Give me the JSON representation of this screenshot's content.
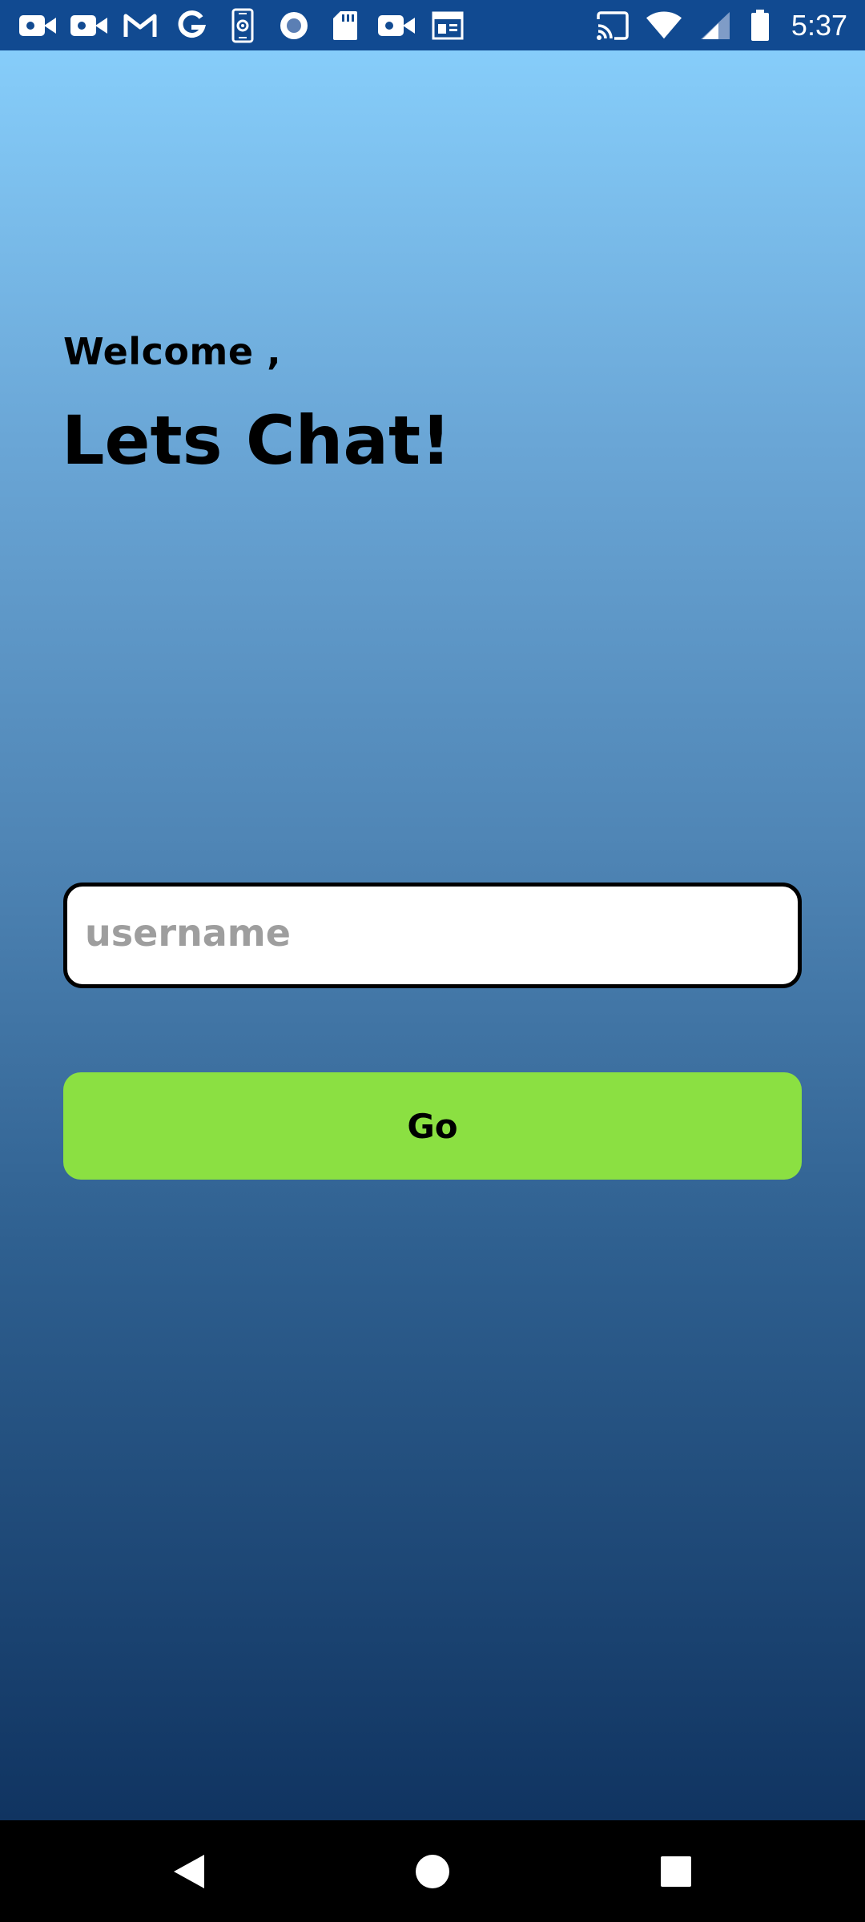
{
  "status_bar": {
    "time": "5:37",
    "left_icons": [
      "video-camera-icon",
      "video-camera-icon",
      "gmail-icon",
      "google-icon",
      "phone-settings-icon",
      "record-circle-icon",
      "sd-card-icon",
      "video-camera-icon",
      "newspaper-icon"
    ],
    "right_icons": [
      "cast-icon",
      "wifi-icon",
      "cell-signal-icon",
      "battery-icon"
    ]
  },
  "screen": {
    "greeting": "Welcome ,",
    "headline": "Lets Chat!",
    "username_placeholder": "username",
    "username_value": "",
    "go_label": "Go"
  },
  "nav_bar": {
    "buttons": [
      "back",
      "home",
      "recents"
    ]
  },
  "colors": {
    "status_bar": "#114a91",
    "gradient_top": "#86cdfa",
    "gradient_bottom": "#103461",
    "go_button": "#8be042",
    "placeholder": "#9e9e9e"
  }
}
